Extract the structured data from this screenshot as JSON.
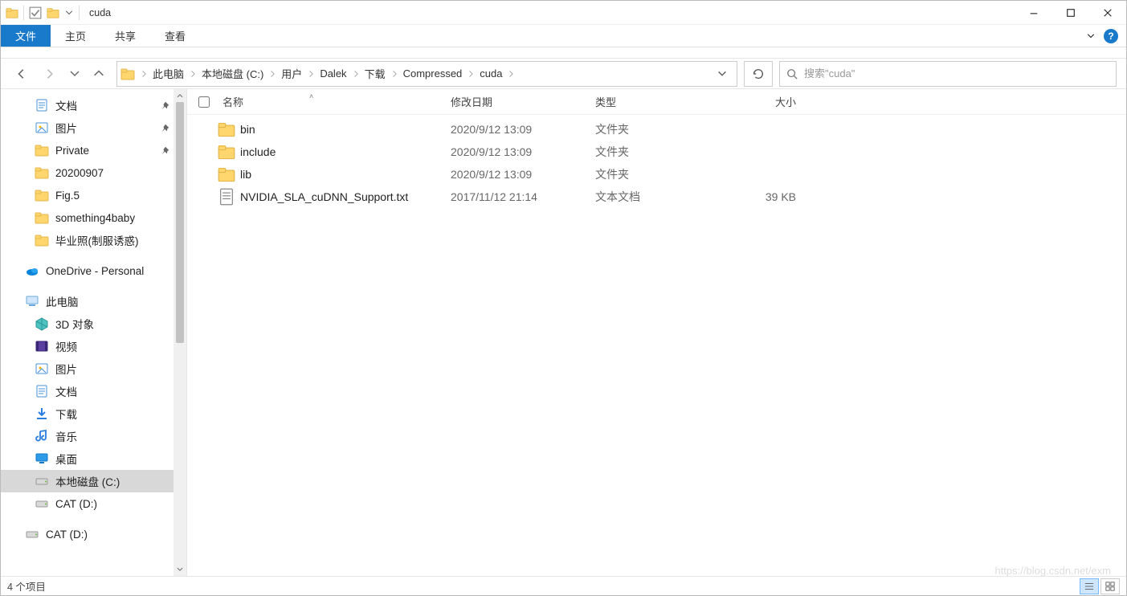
{
  "titlebar": {
    "title": "cuda"
  },
  "ribbon": {
    "file": "文件",
    "tabs": [
      "主页",
      "共享",
      "查看"
    ]
  },
  "nav": {
    "breadcrumbs": [
      "此电脑",
      "本地磁盘 (C:)",
      "用户",
      "Dalek",
      "下载",
      "Compressed",
      "cuda"
    ],
    "search_placeholder": "搜索\"cuda\""
  },
  "sidebar": {
    "quick": [
      {
        "label": "文档",
        "icon": "doc",
        "pinned": true
      },
      {
        "label": "图片",
        "icon": "pic",
        "pinned": true
      },
      {
        "label": "Private",
        "icon": "folder",
        "pinned": true
      },
      {
        "label": "20200907",
        "icon": "folder",
        "pinned": false
      },
      {
        "label": "Fig.5",
        "icon": "folder",
        "pinned": false
      },
      {
        "label": "something4baby",
        "icon": "folder",
        "pinned": false
      },
      {
        "label": "毕业照(制服诱惑)",
        "icon": "folder",
        "pinned": false
      }
    ],
    "onedrive_label": "OneDrive - Personal",
    "thispc_label": "此电脑",
    "thispc": [
      {
        "label": "3D 对象",
        "icon": "3d"
      },
      {
        "label": "视频",
        "icon": "video"
      },
      {
        "label": "图片",
        "icon": "pic"
      },
      {
        "label": "文档",
        "icon": "doc"
      },
      {
        "label": "下载",
        "icon": "download"
      },
      {
        "label": "音乐",
        "icon": "music"
      },
      {
        "label": "桌面",
        "icon": "desktop"
      },
      {
        "label": "本地磁盘 (C:)",
        "icon": "drive",
        "selected": true
      },
      {
        "label": "CAT (D:)",
        "icon": "drive"
      }
    ],
    "extra_drive": "CAT (D:)"
  },
  "columns": {
    "name": "名称",
    "date": "修改日期",
    "type": "类型",
    "size": "大小"
  },
  "files": [
    {
      "name": "bin",
      "date": "2020/9/12 13:09",
      "type": "文件夹",
      "size": "",
      "icon": "folder"
    },
    {
      "name": "include",
      "date": "2020/9/12 13:09",
      "type": "文件夹",
      "size": "",
      "icon": "folder"
    },
    {
      "name": "lib",
      "date": "2020/9/12 13:09",
      "type": "文件夹",
      "size": "",
      "icon": "folder"
    },
    {
      "name": "NVIDIA_SLA_cuDNN_Support.txt",
      "date": "2017/11/12 21:14",
      "type": "文本文档",
      "size": "39 KB",
      "icon": "txt"
    }
  ],
  "status": {
    "count_label": "4 个项目"
  },
  "watermark": "https://blog.csdn.net/exm"
}
